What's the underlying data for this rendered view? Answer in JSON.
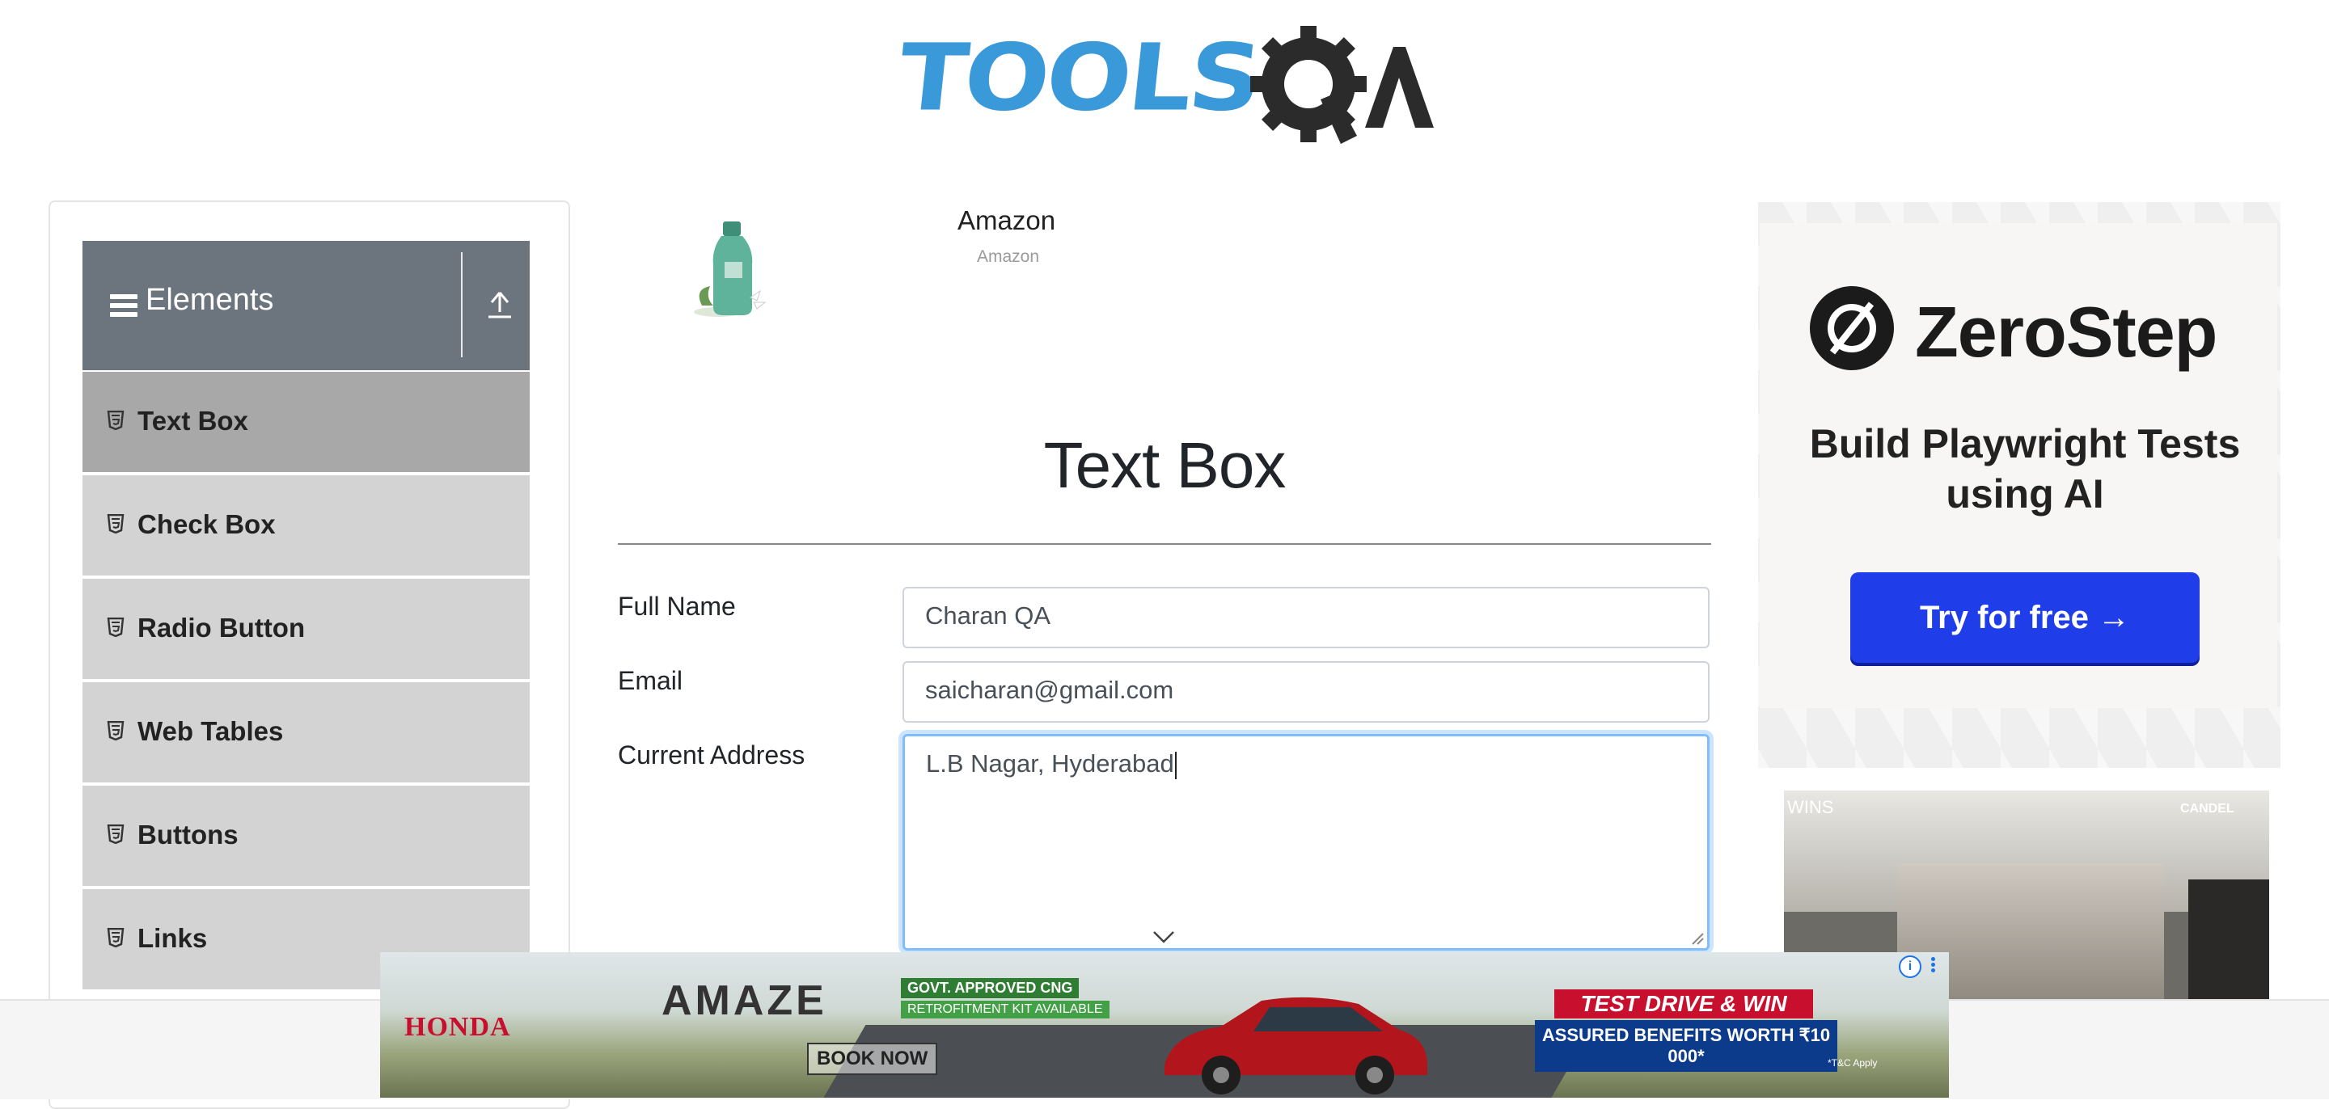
{
  "logo": {
    "text_tools": "TOOLS",
    "text_qa": "QA",
    "brand_color": "#3a9ad9"
  },
  "sidebar": {
    "group_title": "Elements",
    "items": [
      {
        "label": "Text Box",
        "active": true
      },
      {
        "label": "Check Box",
        "active": false
      },
      {
        "label": "Radio Button",
        "active": false
      },
      {
        "label": "Web Tables",
        "active": false
      },
      {
        "label": "Buttons",
        "active": false
      },
      {
        "label": "Links",
        "active": false
      }
    ]
  },
  "amazon_ad": {
    "title": "Amazon",
    "subtitle": "Amazon"
  },
  "main": {
    "header": "Text Box",
    "form": {
      "full_name_label": "Full Name",
      "full_name_value": "Charan QA",
      "email_label": "Email",
      "email_value": "saicharan@gmail.com",
      "address_label": "Current Address",
      "address_value": "L.B Nagar, Hyderabad"
    }
  },
  "right_ad": {
    "brand": "ZeroStep",
    "tagline": "Build Playwright Tests using AI",
    "cta": "Try for free →",
    "cta_color": "#1f3de8",
    "room_ad_left_text": "WINS",
    "room_ad_right_text": "CANDEL"
  },
  "bottom_ad": {
    "brand": "HONDA",
    "model": "AMAZE",
    "govt": "GOVT. APPROVED CNG",
    "retrofit": "RETROFITMENT KIT AVAILABLE",
    "book": "BOOK NOW",
    "test_drive": "TEST DRIVE & WIN",
    "benefits": "ASSURED BENEFITS WORTH ₹10 000*",
    "tc": "*T&C Apply"
  }
}
